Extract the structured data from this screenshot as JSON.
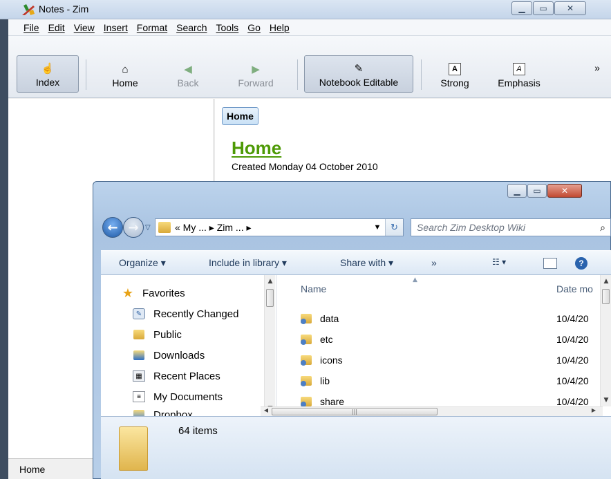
{
  "zim": {
    "title": "Notes - Zim",
    "menu": [
      "File",
      "Edit",
      "View",
      "Insert",
      "Format",
      "Search",
      "Tools",
      "Go",
      "Help"
    ],
    "toolbar": {
      "index": "Index",
      "home": "Home",
      "back": "Back",
      "forward": "Forward",
      "notebook_editable": "Notebook Editable",
      "strong": "Strong",
      "emphasis": "Emphasis",
      "overflow": "»"
    },
    "pathbar": "Home",
    "page": {
      "title": "Home",
      "created": "Created Monday 04 October 2010"
    },
    "status": "Home"
  },
  "explorer": {
    "address": "«  My ...  ▸  Zim ...  ▸",
    "search_placeholder": "Search Zim Desktop Wiki",
    "commands": {
      "organize": "Organize ▾",
      "include": "Include in library ▾",
      "share": "Share with ▾",
      "more": "»"
    },
    "nav": [
      {
        "label": "Favorites",
        "icon": "star-icon"
      },
      {
        "label": "Recently Changed",
        "icon": "recent-changes-icon"
      },
      {
        "label": "Public",
        "icon": "folder-icon"
      },
      {
        "label": "Downloads",
        "icon": "downloads-folder-icon"
      },
      {
        "label": "Recent Places",
        "icon": "recent-places-icon"
      },
      {
        "label": "My Documents",
        "icon": "documents-icon"
      },
      {
        "label": "Dropbox",
        "icon": "dropbox-folder-icon"
      }
    ],
    "columns": {
      "name": "Name",
      "date": "Date mo"
    },
    "files": [
      {
        "name": "data",
        "date": "10/4/20"
      },
      {
        "name": "etc",
        "date": "10/4/20"
      },
      {
        "name": "icons",
        "date": "10/4/20"
      },
      {
        "name": "lib",
        "date": "10/4/20"
      },
      {
        "name": "share",
        "date": "10/4/20"
      }
    ],
    "details": "64 items"
  }
}
